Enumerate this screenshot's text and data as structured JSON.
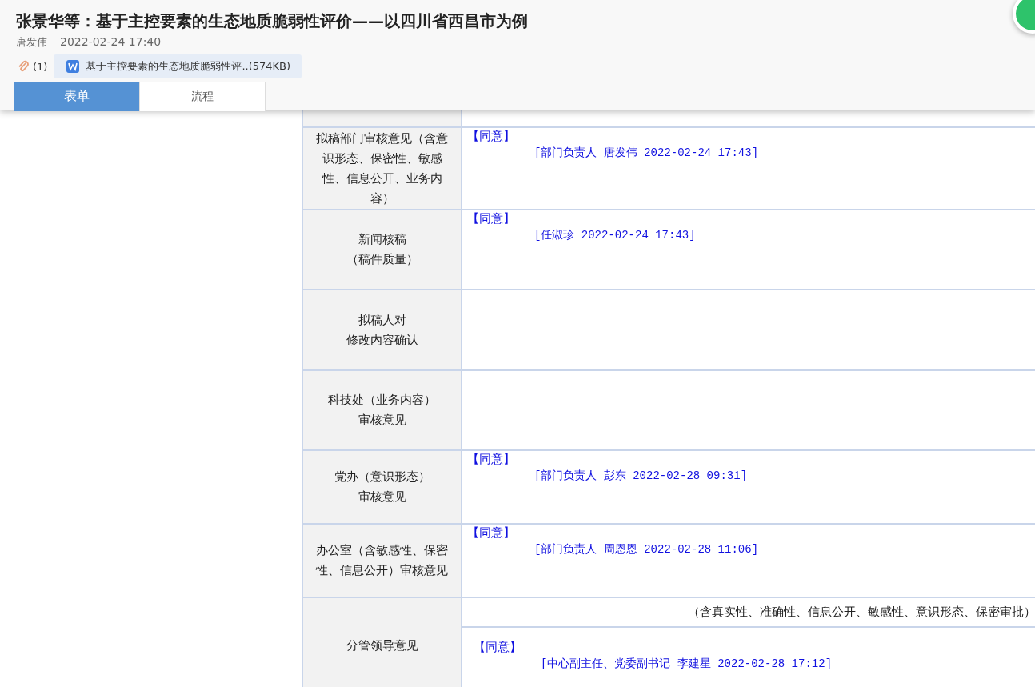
{
  "header": {
    "title": "张景华等：基于主控要素的生态地质脆弱性评价——以四川省西昌市为例",
    "author": "唐发伟",
    "time": "2022-02-24 17:40",
    "attachment_count": "(1)",
    "attachment": "基于主控要素的生态地质脆弱性评..(574KB)",
    "tabs": [
      {
        "label": "表单",
        "selected": true
      },
      {
        "label": "流程",
        "selected": false
      }
    ]
  },
  "form": {
    "rows": [
      {
        "label_lines": [
          "拟稿部门审核意见（含意识形态、保密性、敏感性、信息公开、业务内容）"
        ],
        "opinion": "【同意】",
        "signature": "[部门负责人 唐发伟 2022-02-24 17:43]"
      },
      {
        "label_lines": [
          "新闻核稿",
          "（稿件质量）"
        ],
        "opinion": "【同意】",
        "signature": "[任淑珍 2022-02-24 17:43]"
      },
      {
        "label_lines": [
          "拟稿人对",
          "修改内容确认"
        ]
      },
      {
        "label_lines": [
          "科技处（业务内容）",
          "审核意见"
        ]
      },
      {
        "label_lines": [
          "党办（意识形态）",
          "审核意见"
        ],
        "opinion": "【同意】",
        "signature": "[部门负责人 彭东 2022-02-28 09:31]"
      },
      {
        "label_lines": [
          "办公室（含敏感性、保密性、信息公开）审核意见"
        ],
        "opinion": "【同意】",
        "signature": "[部门负责人 周恩恩 2022-02-28 11:06]"
      },
      {
        "label_lines": [
          "分管领导意见"
        ],
        "note": "（含真实性、准确性、信息公开、敏感性、意识形态、保密审批）",
        "opinion": "【同意】",
        "signature": "[中心副主任、党委副书记 李建星 2022-02-28 17:12]"
      }
    ]
  }
}
